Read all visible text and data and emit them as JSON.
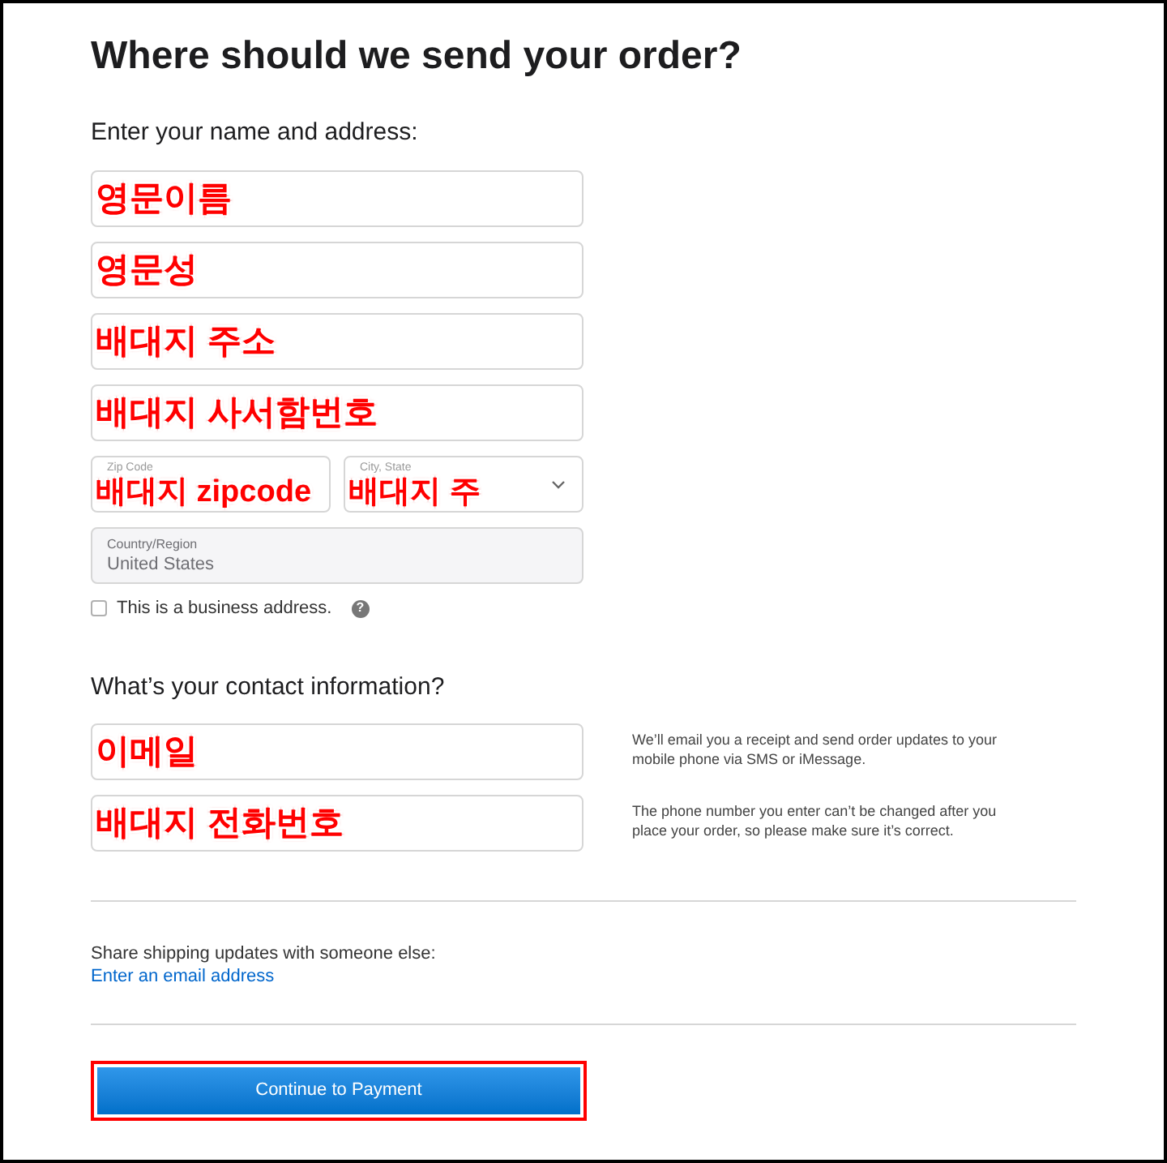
{
  "title": "Where should we send your order?",
  "address_section": {
    "heading": "Enter your name and address:",
    "fields": [
      {
        "annotation": "영문이름"
      },
      {
        "annotation": "영문성"
      },
      {
        "annotation": "배대지 주소"
      },
      {
        "annotation": "배대지 사서함번호"
      }
    ],
    "row_fields": [
      {
        "kind": "text",
        "label": "Zip Code",
        "annotation": "배대지 zipcode"
      },
      {
        "kind": "select",
        "label": "City, State",
        "annotation": "배대지 주"
      }
    ],
    "country": {
      "label": "Country/Region",
      "value": "United States",
      "disabled": true
    },
    "business": {
      "label": "This is a business address.",
      "checked": false,
      "help": "?"
    }
  },
  "contact_section": {
    "heading": "What’s your contact information?",
    "fields": [
      {
        "annotation": "이메일",
        "note": "We’ll email you a receipt and send order updates to your mobile phone via SMS or iMessage."
      },
      {
        "annotation": "배대지 전화번호",
        "note": "The phone number you enter can’t be changed after you place your order, so please make sure it’s correct."
      }
    ]
  },
  "share": {
    "text": "Share shipping updates with someone else:",
    "link": "Enter an email address"
  },
  "button": {
    "label": "Continue to Payment",
    "highlighted": true
  }
}
